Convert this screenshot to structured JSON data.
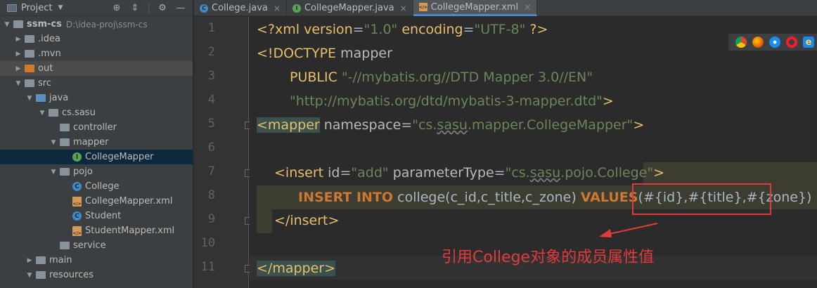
{
  "project_panel": {
    "title": "Project",
    "tree": [
      {
        "label": "ssm-cs",
        "note": "D:\\idea-proj\\ssm-cs",
        "type": "module",
        "expanded": true
      },
      {
        "label": ".idea",
        "type": "folder",
        "expanded": false
      },
      {
        "label": ".mvn",
        "type": "folder",
        "expanded": false
      },
      {
        "label": "out",
        "type": "folder-orange",
        "expanded": false
      },
      {
        "label": "src",
        "type": "folder",
        "expanded": true
      },
      {
        "label": "java",
        "type": "folder-blue",
        "expanded": true
      },
      {
        "label": "cs.sasu",
        "type": "package",
        "expanded": true
      },
      {
        "label": "controller",
        "type": "package"
      },
      {
        "label": "mapper",
        "type": "package",
        "expanded": true
      },
      {
        "label": "CollegeMapper",
        "type": "interface",
        "selected": true
      },
      {
        "label": "pojo",
        "type": "package",
        "expanded": true
      },
      {
        "label": "College",
        "type": "class"
      },
      {
        "label": "CollegeMapper.xml",
        "type": "xml"
      },
      {
        "label": "Student",
        "type": "class"
      },
      {
        "label": "StudentMapper.xml",
        "type": "xml"
      },
      {
        "label": "service",
        "type": "package"
      },
      {
        "label": "main",
        "type": "folder",
        "expanded": false
      },
      {
        "label": "resources",
        "type": "folder-res",
        "expanded": true
      }
    ]
  },
  "tabs": [
    {
      "label": "College.java",
      "icon": "class-icon",
      "active": false
    },
    {
      "label": "CollegeMapper.java",
      "icon": "interface-icon",
      "active": false
    },
    {
      "label": "CollegeMapper.xml",
      "icon": "xml-icon",
      "active": true
    }
  ],
  "editor": {
    "line_numbers": [
      "1",
      "2",
      "3",
      "4",
      "5",
      "6",
      "7",
      "8",
      "9",
      "10",
      "11"
    ],
    "code": {
      "l1_a": "<?xml version",
      "l1_eq1": "=",
      "l1_v1": "\"1.0\"",
      "l1_b": " encoding",
      "l1_eq2": "=",
      "l1_v2": "\"UTF-8\"",
      "l1_c": " ?>",
      "l2_a": "<!DOCTYPE ",
      "l2_b": "mapper",
      "l3_a": "PUBLIC ",
      "l3_b": "\"-//mybatis.org//DTD Mapper 3.0//EN\"",
      "l4_a": "\"http://mybatis.org/dtd/mybatis-3-mapper.dtd\"",
      "l4_b": ">",
      "l5_tag": "<mapper",
      "l5_attr": " namespace",
      "l5_eq": "=",
      "l5_v_a": "\"cs.",
      "l5_v_b": "sasu",
      "l5_v_c": ".mapper.CollegeMapper\"",
      "l5_close": ">",
      "l7_tag": "<insert",
      "l7_attr1": " id",
      "l7_eq1": "=",
      "l7_v1": "\"add\"",
      "l7_attr2": " parameterType",
      "l7_eq2": "=",
      "l7_v2_a": "\"cs.",
      "l7_v2_b": "sasu",
      "l7_v2_c": ".pojo.College\"",
      "l7_close": ">",
      "l8_kw1": "INSERT INTO",
      "l8_a": " college(c_id,c_title,c_zone) ",
      "l8_kw2": "VALUES",
      "l8_b": "(#{id},#{title},#{zone})",
      "l9_tag": "</insert>",
      "l11_tag": "</mapper>"
    }
  },
  "annotation": "引用College对象的成员属性值",
  "browser_icons": [
    "chrome-icon",
    "firefox-icon",
    "safari-icon",
    "opera-icon",
    "ie-icon"
  ],
  "colors": {
    "tag": "#e8bf6a",
    "string": "#6a8759",
    "keyword": "#cc7832",
    "annotation": "#e23b3b"
  }
}
